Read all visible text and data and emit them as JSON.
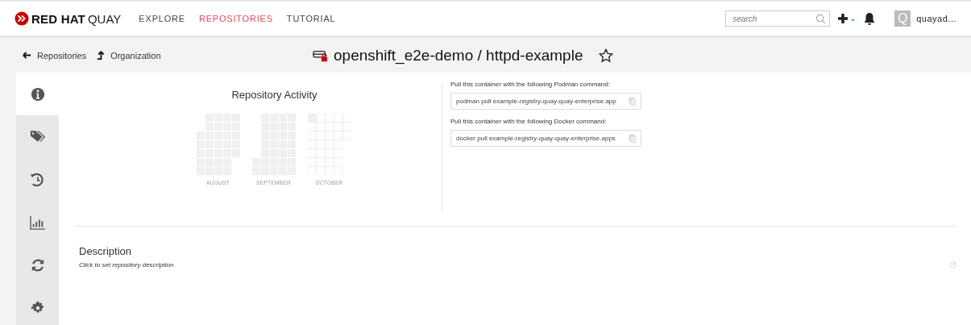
{
  "navbar": {
    "brand": "RED HAT",
    "brand_suffix": "QUAY",
    "links": [
      {
        "label": "EXPLORE",
        "selected": false
      },
      {
        "label": "REPOSITORIES",
        "selected": true
      },
      {
        "label": "TUTORIAL",
        "selected": false
      }
    ],
    "search": {
      "placeholder": "search"
    },
    "avatar_letter": "Q",
    "username": "quayad..."
  },
  "breadcrumbs": [
    {
      "kind": "back",
      "label": "Repositories"
    },
    {
      "kind": "up",
      "label": "Organization"
    }
  ],
  "title": "openshift_e2e-demo / httpd-example",
  "sidebar": [
    {
      "kind": "info",
      "selected": true
    },
    {
      "kind": "tags",
      "selected": false
    },
    {
      "kind": "history",
      "selected": false
    },
    {
      "kind": "usage",
      "selected": false
    },
    {
      "kind": "builds",
      "selected": false
    },
    {
      "kind": "settings",
      "selected": false
    }
  ],
  "activity": {
    "title": "Repository Activity",
    "months": [
      "AUGUST",
      "SEPTEMBER",
      "OCTOBER"
    ]
  },
  "pull_commands": [
    {
      "label": "Pull this container with the following Podman command:",
      "value": "podman pull example-registry-quay-quay-enterprise.app"
    },
    {
      "label": "Pull this container with the following Docker command:",
      "value": "docker pull example-registry-quay-quay-enterprise.apps"
    }
  ],
  "description": {
    "heading": "Description",
    "placeholder": "Click to set repository description"
  }
}
